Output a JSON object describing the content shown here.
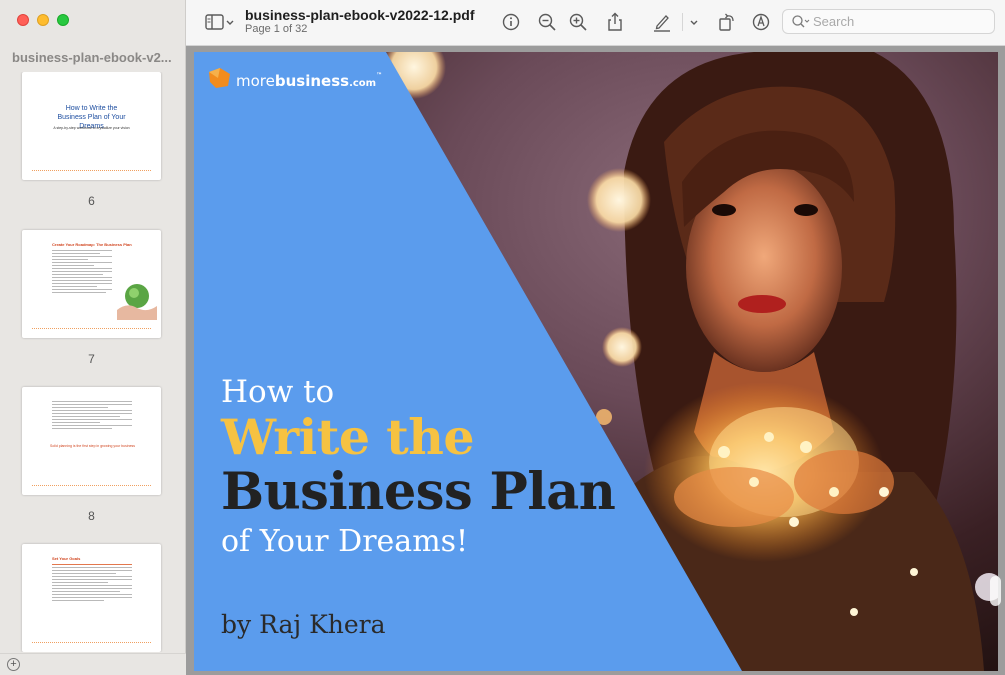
{
  "sidebar": {
    "title": "business-plan-ebook-v2...",
    "pages": [
      {
        "number": "6",
        "title": "How to Write the Business Plan of Your Dreams",
        "subtitle": "A step-by-step workbook to crystallize your vision"
      },
      {
        "number": "7",
        "heading": "Create Your Roadmap: The Business Plan"
      },
      {
        "number": "8",
        "highlight": "Solid planning is the first step in growing your business"
      },
      {
        "number": "9",
        "heading": "Set Your Goals"
      }
    ]
  },
  "toolbar": {
    "doc_title": "business-plan-ebook-v2022-12.pdf",
    "page_info": "Page 1 of 32",
    "search_placeholder": "Search"
  },
  "icons": [
    "sidebar-toggle-icon",
    "chevron-down-icon",
    "info-icon",
    "zoom-out-icon",
    "zoom-in-icon",
    "share-icon",
    "highlight-pen-icon",
    "rotate-icon",
    "markup-icon",
    "search-icon",
    "add-icon"
  ],
  "cover": {
    "logo_more": "more",
    "logo_business": "business",
    "logo_com": ".com",
    "logo_tm": "™",
    "line1": "How to",
    "line2": "Write the",
    "line3": "Business Plan",
    "line4": "of Your Dreams!",
    "author": "by Raj Khera"
  },
  "colors": {
    "cover_blue": "#5b9ced",
    "title_yellow": "#f6c242",
    "title_dark": "#222222",
    "logo_orange": "#f28c1e"
  }
}
